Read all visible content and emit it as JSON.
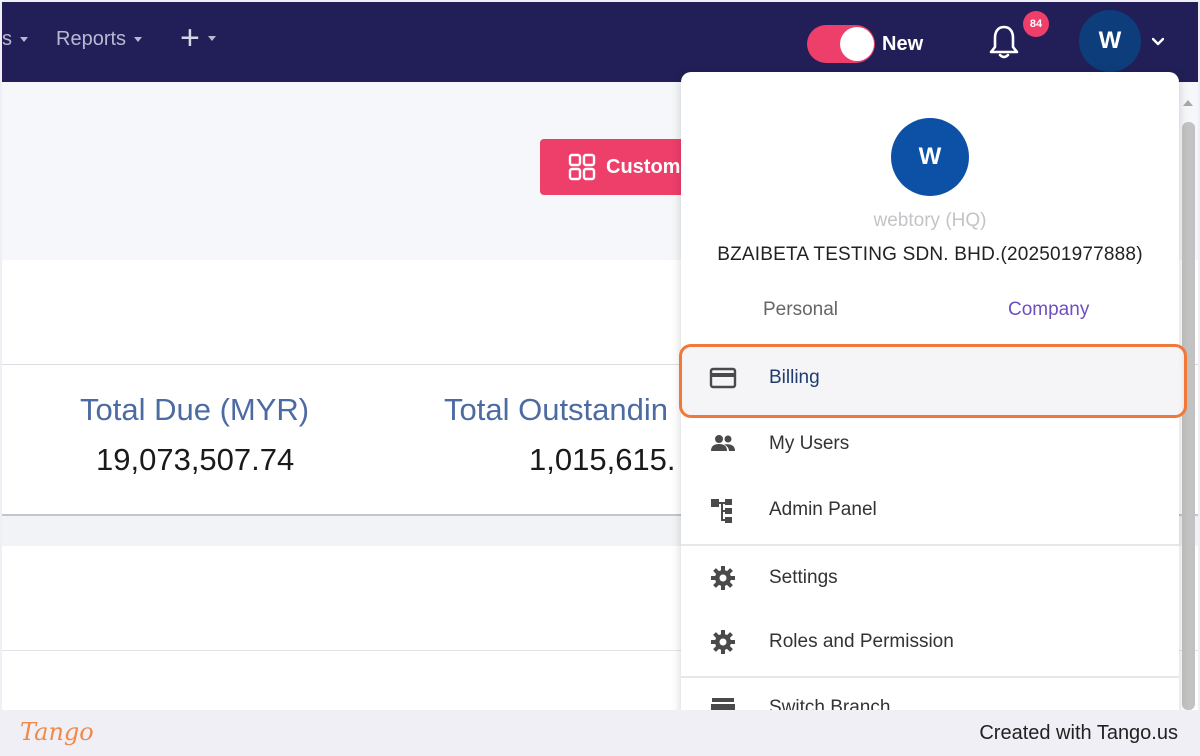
{
  "nav": {
    "partial_item": "s",
    "reports": "Reports",
    "plus": "+",
    "toggle_label": "New",
    "notification_count": "84",
    "avatar_initial": "W"
  },
  "toolbar": {
    "customize_label": "Custom"
  },
  "stats": [
    {
      "label": "Total Due (MYR)",
      "value": "19,073,507.74"
    },
    {
      "label": "Total Outstandin",
      "value": "1,015,615."
    }
  ],
  "dropdown": {
    "avatar_initial": "W",
    "subtitle": "webtory (HQ)",
    "company": "BZAIBETA TESTING SDN. BHD.(202501977888)",
    "tabs": {
      "personal": "Personal",
      "company": "Company"
    },
    "items": [
      {
        "label": "Billing",
        "icon": "credit-card-icon"
      },
      {
        "label": "My Users",
        "icon": "users-icon"
      },
      {
        "label": "Admin Panel",
        "icon": "hierarchy-icon"
      },
      {
        "label": "Settings",
        "icon": "gear-icon"
      },
      {
        "label": "Roles and Permission",
        "icon": "gear-icon"
      },
      {
        "label": "Switch Branch",
        "icon": "store-icon"
      }
    ]
  },
  "footer": {
    "logo": "Tango",
    "credit": "Created with Tango.us"
  },
  "colors": {
    "nav_bg": "#221f58",
    "accent": "#ee3e6a",
    "highlight": "#f07838",
    "avatar": "#0d51a6",
    "link": "#6f4fbf"
  }
}
